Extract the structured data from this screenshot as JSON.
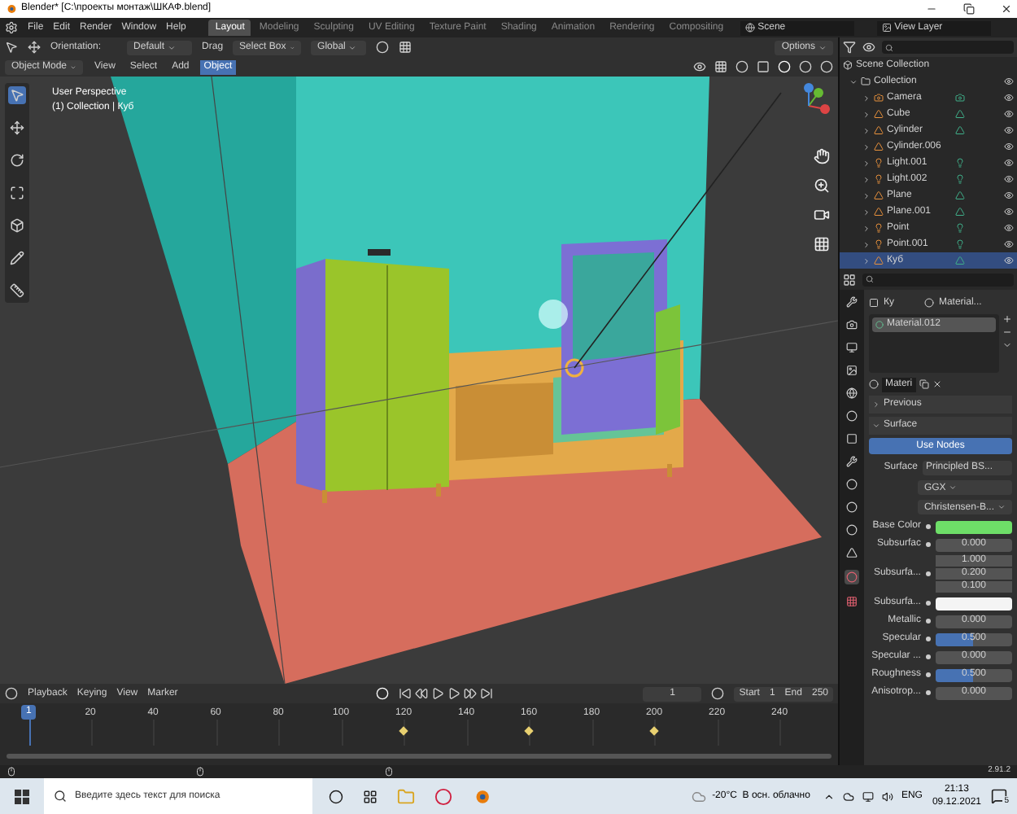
{
  "window": {
    "title": "Blender* [C:\\проекты монтаж\\ШКАФ.blend]"
  },
  "menu": [
    "File",
    "Edit",
    "Render",
    "Window",
    "Help"
  ],
  "workspaces": [
    {
      "label": "Layout",
      "selected": true
    },
    {
      "label": "Modeling",
      "selected": false
    },
    {
      "label": "Sculpting",
      "selected": false
    },
    {
      "label": "UV Editing",
      "selected": false
    },
    {
      "label": "Texture Paint",
      "selected": false
    },
    {
      "label": "Shading",
      "selected": false
    },
    {
      "label": "Animation",
      "selected": false
    },
    {
      "label": "Rendering",
      "selected": false
    },
    {
      "label": "Compositing",
      "selected": false
    }
  ],
  "scene": "Scene",
  "view_layer": "View Layer",
  "tool_header": {
    "orientation_label": "Orientation:",
    "orientation": "Default",
    "drag_label": "Drag",
    "drag": "Select Box",
    "transform": "Global",
    "options": "Options"
  },
  "viewport_header": {
    "mode": "Object Mode",
    "menus": [
      {
        "label": "View",
        "selected": false
      },
      {
        "label": "Select",
        "selected": false
      },
      {
        "label": "Add",
        "selected": false
      },
      {
        "label": "Object",
        "selected": true
      }
    ]
  },
  "viewport": {
    "overlay": [
      "User Perspective",
      "(1) Collection | Куб"
    ]
  },
  "outliner": {
    "root": "Scene Collection",
    "collection": "Collection",
    "items": [
      {
        "name": "Camera",
        "kind": "camera",
        "data": true,
        "selected": false
      },
      {
        "name": "Cube",
        "kind": "mesh",
        "data": true,
        "selected": false
      },
      {
        "name": "Cylinder",
        "kind": "mesh",
        "data": true,
        "selected": false
      },
      {
        "name": "Cylinder.006",
        "kind": "mesh",
        "data": false,
        "selected": false
      },
      {
        "name": "Light.001",
        "kind": "light",
        "data": true,
        "selected": false
      },
      {
        "name": "Light.002",
        "kind": "light",
        "data": true,
        "selected": false
      },
      {
        "name": "Plane",
        "kind": "mesh",
        "data": true,
        "selected": false
      },
      {
        "name": "Plane.001",
        "kind": "mesh",
        "data": true,
        "selected": false
      },
      {
        "name": "Point",
        "kind": "light",
        "data": true,
        "selected": false
      },
      {
        "name": "Point.001",
        "kind": "light",
        "data": true,
        "selected": false
      },
      {
        "name": "Куб",
        "kind": "mesh",
        "data": true,
        "selected": true
      }
    ]
  },
  "properties": {
    "object": "Ку",
    "material_field": "Material...",
    "slots": [
      {
        "name": "Material.012",
        "selected": true
      }
    ],
    "material_name": "Materi",
    "panels": [
      {
        "label": "Previous",
        "expanded": false
      },
      {
        "label": "Surface",
        "expanded": true
      }
    ],
    "use_nodes": "Use Nodes",
    "surface_label": "Surface",
    "surface": "Principled BS...",
    "distribution": "GGX",
    "subsurface_method": "Christensen-B...",
    "inputs": [
      {
        "kind": "color",
        "label": "Base Color",
        "color": "#6ede68"
      },
      {
        "kind": "value",
        "label": "Subsurfac",
        "value": "0.000"
      },
      {
        "kind": "vector",
        "label": "Subsurfa...",
        "values": [
          "1.000",
          "0.200",
          "0.100"
        ]
      },
      {
        "kind": "color",
        "label": "Subsurfa...",
        "color": "#f4f4f4"
      },
      {
        "kind": "value",
        "label": "Metallic",
        "value": "0.000"
      },
      {
        "kind": "slider",
        "label": "Specular",
        "value": "0.500",
        "level": 0.5
      },
      {
        "kind": "value",
        "label": "Specular ...",
        "value": "0.000"
      },
      {
        "kind": "slider",
        "label": "Roughness",
        "value": "0.500",
        "level": 0.5
      },
      {
        "kind": "value",
        "label": "Anisotrop...",
        "value": "0.000"
      }
    ]
  },
  "timeline": {
    "menus": [
      "Playback",
      "Keying",
      "View",
      "Marker"
    ],
    "frame": "1",
    "start_label": "Start",
    "start": "1",
    "end_label": "End",
    "end": "250",
    "playhead": "1",
    "ruler": [
      {
        "label": "20",
        "keyframe": false
      },
      {
        "label": "40",
        "keyframe": false
      },
      {
        "label": "60",
        "keyframe": false
      },
      {
        "label": "80",
        "keyframe": false
      },
      {
        "label": "100",
        "keyframe": false
      },
      {
        "label": "120",
        "keyframe": true
      },
      {
        "label": "140",
        "keyframe": false
      },
      {
        "label": "160",
        "keyframe": true
      },
      {
        "label": "180",
        "keyframe": false
      },
      {
        "label": "200",
        "keyframe": true
      },
      {
        "label": "220",
        "keyframe": false
      },
      {
        "label": "240",
        "keyframe": false
      }
    ]
  },
  "version": "2.91.2",
  "taskbar": {
    "search_placeholder": "Введите здесь текст для поиска",
    "weather": "-20°C  В осн. облачно",
    "language": "ENG",
    "time": "21:13",
    "date": "09.12.2021",
    "notifications": "5"
  }
}
